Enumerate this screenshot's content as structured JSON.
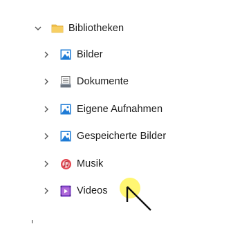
{
  "tree": {
    "root": {
      "label": "Bibliotheken",
      "icon": "folder-icon",
      "expanded": true
    },
    "items": [
      {
        "label": "Bilder",
        "icon": "pictures-icon"
      },
      {
        "label": "Dokumente",
        "icon": "documents-icon"
      },
      {
        "label": "Eigene Aufnahmen",
        "icon": "camera-roll-icon"
      },
      {
        "label": "Gespeicherte Bilder",
        "icon": "saved-pictures-icon"
      },
      {
        "label": "Musik",
        "icon": "music-icon"
      },
      {
        "label": "Videos",
        "icon": "videos-icon"
      }
    ]
  },
  "colors": {
    "folder": "#f2c14e",
    "pictures": "#1e7bd6",
    "music": "#e3454f",
    "videos": "#7b3fc4",
    "cursor_highlight": "#fff66a"
  }
}
